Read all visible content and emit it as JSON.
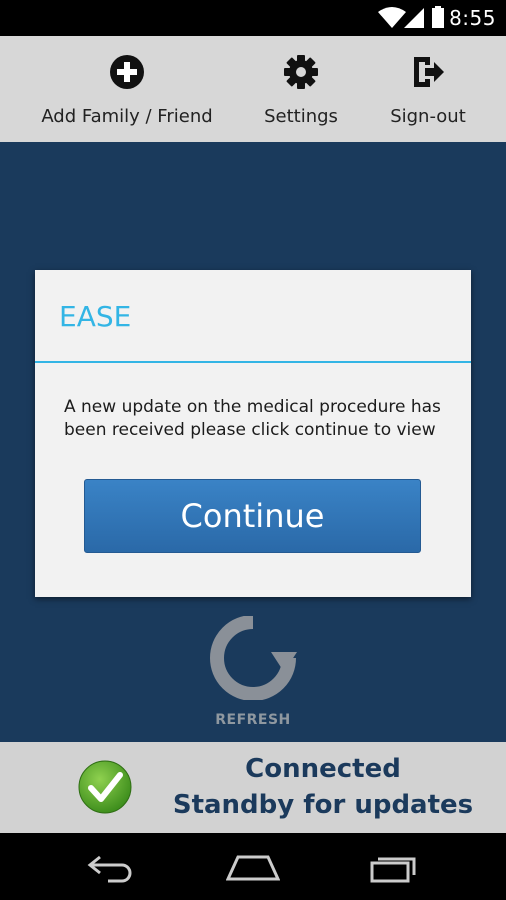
{
  "status_bar": {
    "time": "8:55",
    "icons": [
      "wifi-icon",
      "cell-signal-icon",
      "battery-icon"
    ]
  },
  "toolbar": {
    "items": [
      {
        "label": "Add Family / Friend",
        "icon": "add-circle-icon"
      },
      {
        "label": "Settings",
        "icon": "gear-icon"
      },
      {
        "label": "Sign-out",
        "icon": "sign-out-icon"
      }
    ]
  },
  "dialog": {
    "title": "EASE",
    "message": "A new update on the medical procedure has been received please click continue to view",
    "button_label": "Continue"
  },
  "refresh": {
    "label": "REFRESH",
    "icon": "refresh-icon"
  },
  "connection": {
    "line1": "Connected",
    "line2": "Standby for updates",
    "icon": "green-check-icon"
  },
  "nav_bar": {
    "icons": [
      "back-icon",
      "home-icon",
      "recents-icon"
    ]
  },
  "colors": {
    "accent": "#33b5e5",
    "background": "#1a3a5c",
    "button": "#2f75b8",
    "toolbar": "#d7d7d7",
    "status_text": "#1b3a5c"
  }
}
